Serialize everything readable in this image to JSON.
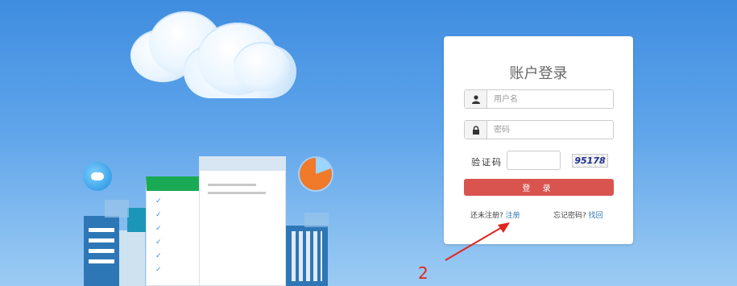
{
  "login": {
    "title": "账户登录",
    "username_placeholder": "用户名",
    "password_placeholder": "密码",
    "captcha_label": "验证码",
    "captcha_code": "95178",
    "login_button": "登 录",
    "register_prompt": "还未注册?",
    "register_link": "注册",
    "forgot_prompt": "忘记密码?",
    "recover_link": "找回"
  },
  "annotation": {
    "number": "2",
    "color": "#e0261f"
  },
  "icons": {
    "username": "user-icon",
    "password": "lock-icon"
  },
  "colors": {
    "background_top": "#3f8de0",
    "login_button": "#d9534f",
    "link": "#337ab7"
  }
}
